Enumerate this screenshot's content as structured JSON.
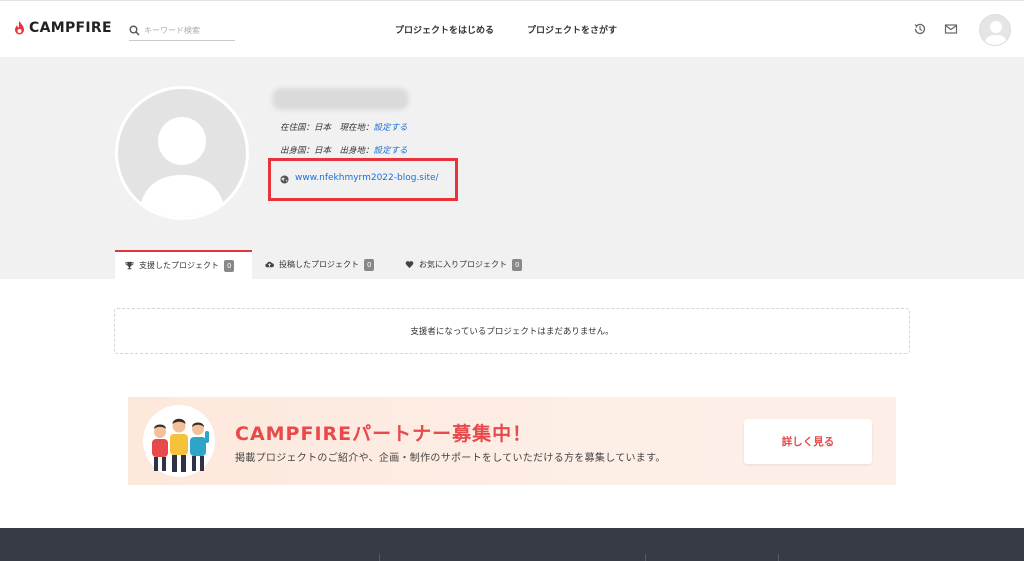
{
  "header": {
    "logo_text": "CAMPFIRE",
    "search_placeholder": "キーワード検索",
    "nav": {
      "start_project": "プロジェクトをはじめる",
      "find_project": "プロジェクトをさがす"
    },
    "icons": [
      "history-icon",
      "mail-icon",
      "avatar"
    ]
  },
  "profile": {
    "residence_label": "在住国：日本　現在地：",
    "residence_link": "設定する",
    "origin_label": "出身国：日本　出身地：",
    "origin_link": "設定する",
    "website": "www.nfekhmyrm2022-blog.site/"
  },
  "tabs": [
    {
      "label": "支援したプロジェクト",
      "count": "0",
      "icon": "trophy-icon"
    },
    {
      "label": "投稿したプロジェクト",
      "count": "0",
      "icon": "cloud-upload-icon"
    },
    {
      "label": "お気に入りプロジェクト",
      "count": "0",
      "icon": "heart-icon"
    }
  ],
  "empty_message": "支援者になっているプロジェクトはまだありません。",
  "banner": {
    "title": "CAMPFIREパートナー募集中！",
    "subtitle": "掲載プロジェクトのご紹介や、企画・制作のサポートをしていただける方を募集しています。",
    "button": "詳しく見る"
  },
  "colors": {
    "accent": "#e8333c",
    "link": "#1a6fd6",
    "footer": "#363b44",
    "banner_bg": "#fde8dc"
  }
}
